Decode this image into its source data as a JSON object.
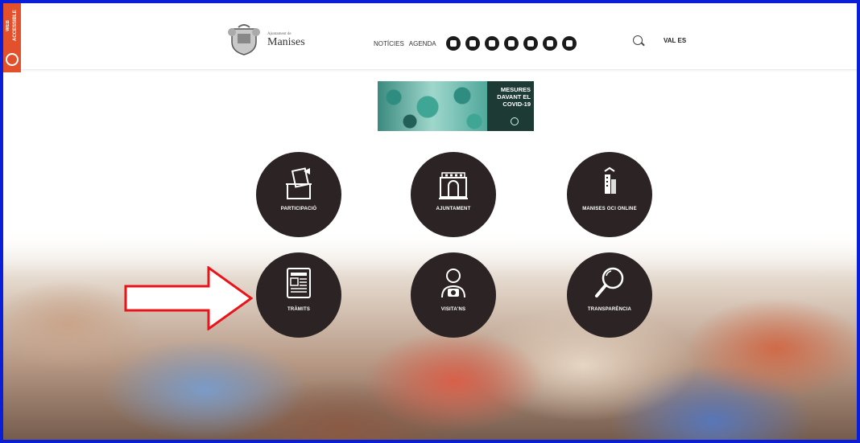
{
  "header": {
    "accessibility_badge": "WEB ACCESSIBLE",
    "logo_small": "Ajuntament de",
    "logo_big": "Manises",
    "nav": [
      "NOTÍCIES",
      "AGENDA"
    ],
    "social_icons": [
      "facebook-icon",
      "twitter-icon",
      "instagram-icon",
      "pinterest-icon",
      "youtube-icon",
      "whatsapp-icon",
      "rss-icon"
    ],
    "lang": "VAL ES"
  },
  "banner": {
    "text": "MESURES DAVANT EL COVID-19"
  },
  "tiles": [
    {
      "label": "PARTICIPACIÓ",
      "icon": "ballot-box-icon"
    },
    {
      "label": "AJUNTAMENT",
      "icon": "town-hall-icon"
    },
    {
      "label": "MANISES OCI ONLINE",
      "icon": "city-icon"
    },
    {
      "label": "TRÀMITS",
      "icon": "newspaper-icon"
    },
    {
      "label": "VISITA'NS",
      "icon": "visitor-camera-icon"
    },
    {
      "label": "TRANSPARÈNCIA",
      "icon": "magnifier-icon"
    }
  ],
  "colors": {
    "frame": "#0a1ed8",
    "badge": "#e2512c",
    "tile": "#2c2424",
    "arrow": "#e8141a"
  }
}
